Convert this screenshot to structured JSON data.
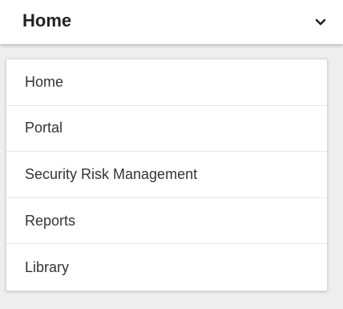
{
  "header": {
    "title": "Home",
    "toggle_icon": "chevron-down-icon"
  },
  "menu": {
    "items": [
      {
        "label": "Home"
      },
      {
        "label": "Portal"
      },
      {
        "label": "Security Risk Management"
      },
      {
        "label": "Reports"
      },
      {
        "label": "Library"
      }
    ]
  }
}
